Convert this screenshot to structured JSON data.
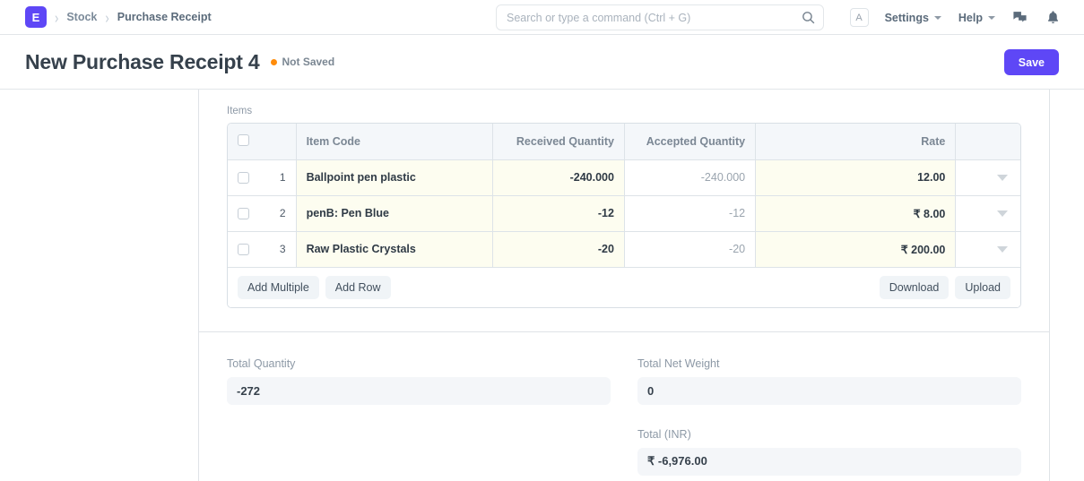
{
  "navbar": {
    "logo_letter": "E",
    "breadcrumbs": [
      {
        "label": "Stock"
      },
      {
        "label": "Purchase Receipt"
      }
    ],
    "search": {
      "placeholder": "Search or type a command (Ctrl + G)",
      "value": ""
    },
    "avatar_letter": "A",
    "menus": [
      {
        "label": "Settings"
      },
      {
        "label": "Help"
      }
    ],
    "icons": {
      "search": "search-icon",
      "comments": "comments-icon",
      "notifications": "bell-icon"
    }
  },
  "page": {
    "title": "New Purchase Receipt 4",
    "status": "Not Saved",
    "status_color": "#ff8c0a",
    "save_label": "Save",
    "accent_color": "#5e47f6"
  },
  "items_section": {
    "label": "Items",
    "columns": [
      {
        "key": "check",
        "label": "",
        "align": "left"
      },
      {
        "key": "item_code",
        "label": "Item Code",
        "align": "left"
      },
      {
        "key": "received_qty",
        "label": "Received Quantity",
        "align": "right"
      },
      {
        "key": "accepted_qty",
        "label": "Accepted Quantity",
        "align": "right"
      },
      {
        "key": "rate",
        "label": "Rate",
        "align": "right"
      },
      {
        "key": "dropdown",
        "label": "",
        "align": "right"
      }
    ],
    "rows": [
      {
        "index": "1",
        "item_code": "Ballpoint pen plastic",
        "received_qty": "-240.000",
        "accepted_qty": "-240.000",
        "rate": "12.00"
      },
      {
        "index": "2",
        "item_code": "penB: Pen Blue",
        "received_qty": "-12",
        "accepted_qty": "-12",
        "rate": "₹ 8.00"
      },
      {
        "index": "3",
        "item_code": "Raw Plastic Crystals",
        "received_qty": "-20",
        "accepted_qty": "-20",
        "rate": "₹ 200.00"
      }
    ],
    "footer_buttons": {
      "add_multiple": "Add Multiple",
      "add_row": "Add Row",
      "download": "Download",
      "upload": "Upload"
    }
  },
  "totals": {
    "total_quantity": {
      "label": "Total Quantity",
      "value": "-272"
    },
    "total_net_weight": {
      "label": "Total Net Weight",
      "value": "0"
    },
    "total_inr": {
      "label": "Total (INR)",
      "value": "₹ -6,976.00"
    }
  }
}
